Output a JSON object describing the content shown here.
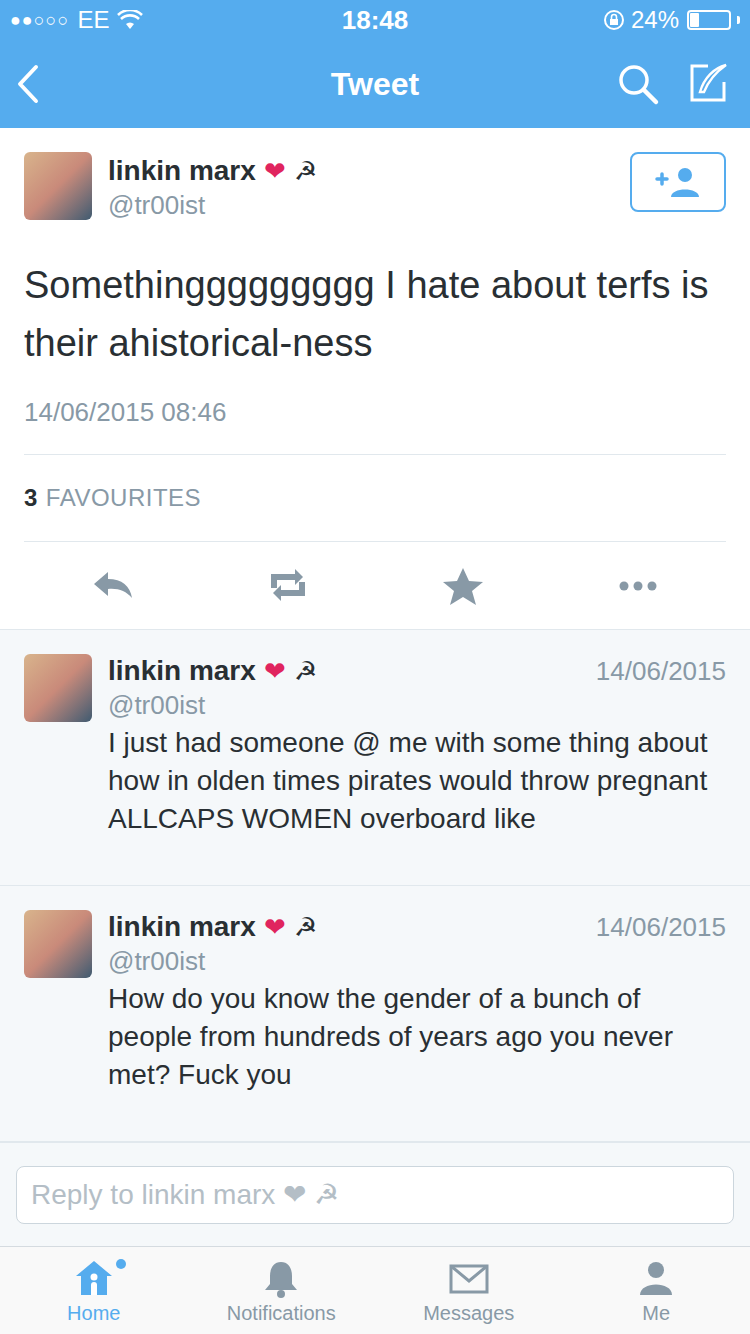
{
  "status_bar": {
    "signal": "●●○○○",
    "carrier": "EE",
    "time": "18:48",
    "battery": "24%",
    "battery_level": 0.24
  },
  "nav": {
    "title": "Tweet"
  },
  "tweet": {
    "author": {
      "name": "linkin marx",
      "emoji": [
        {
          "char": "❤",
          "color": "#e0245e"
        },
        {
          "char": "☭",
          "color": "#292f33"
        }
      ],
      "handle": "@tr00ist"
    },
    "text": "Somethinggggggggg I hate about terfs is their ahistorical-ness",
    "timestamp": "14/06/2015 08:46",
    "favourites": {
      "count": "3",
      "label": "FAVOURITES"
    }
  },
  "replies": [
    {
      "name": "linkin marx",
      "emoji": [
        {
          "char": "❤",
          "color": "#e0245e"
        },
        {
          "char": "☭",
          "color": "#292f33"
        }
      ],
      "handle": "@tr00ist",
      "date": "14/06/2015",
      "text": "I just had someone @ me with some thing about how in olden times pirates would throw pregnant ALLCAPS WOMEN overboard like"
    },
    {
      "name": "linkin marx",
      "emoji": [
        {
          "char": "❤",
          "color": "#e0245e"
        },
        {
          "char": "☭",
          "color": "#292f33"
        }
      ],
      "handle": "@tr00ist",
      "date": "14/06/2015",
      "text": "How do you know the gender of a bunch of people from hundreds of years ago you never met? Fuck you"
    }
  ],
  "reply_box": {
    "placeholder": "Reply to linkin marx ❤ ☭"
  },
  "tab_bar": [
    {
      "label": "Home",
      "selected": true,
      "dot": true
    },
    {
      "label": "Notifications",
      "selected": false,
      "dot": false
    },
    {
      "label": "Messages",
      "selected": false,
      "dot": false
    },
    {
      "label": "Me",
      "selected": false,
      "dot": false
    }
  ]
}
